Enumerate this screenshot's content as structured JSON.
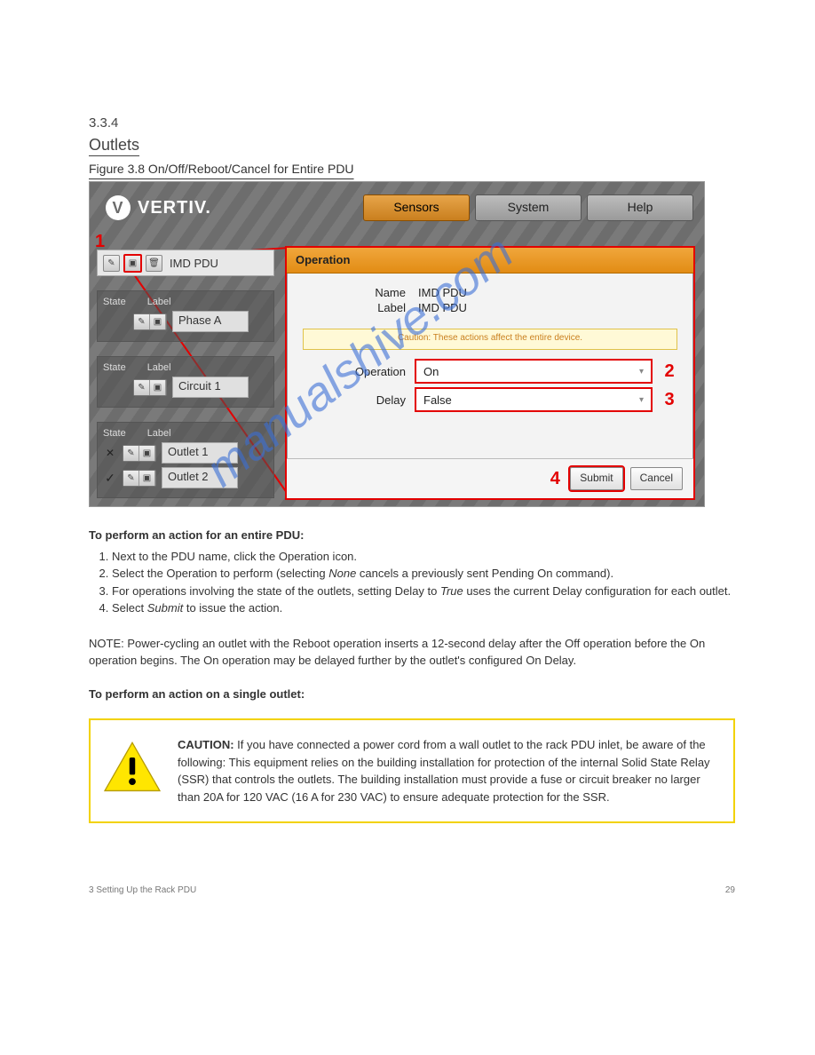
{
  "doc": {
    "section_number": "3.3.4",
    "section_title": "Outlets",
    "figure_caption": "Figure 3.8 On/Off/Reboot/Cancel for Entire PDU",
    "watermark": "manualshive.com",
    "footer_left": "3 Setting Up the Rack PDU",
    "footer_right": "29"
  },
  "app": {
    "brand": "VERTIV.",
    "nav": {
      "sensors": "Sensors",
      "system": "System",
      "help": "Help"
    },
    "callouts": {
      "one": "1",
      "two": "2",
      "three": "3",
      "four": "4"
    },
    "left": {
      "pdu_label": "IMD PDU",
      "state_header": "State",
      "label_header": "Label",
      "phase_label": "Phase A",
      "circuit_label": "Circuit 1",
      "outlets": [
        {
          "state": "✕",
          "label": "Outlet 1"
        },
        {
          "state": "✓",
          "label": "Outlet 2"
        }
      ]
    },
    "dialog": {
      "title": "Operation",
      "name_label": "Name",
      "name_value": "IMD PDU",
      "label_label": "Label",
      "label_value": "IMD PDU",
      "caution": "Caution: These actions affect the entire device.",
      "operation_label": "Operation",
      "operation_value": "On",
      "delay_label": "Delay",
      "delay_value": "False",
      "submit": "Submit",
      "cancel": "Cancel"
    }
  },
  "steps": {
    "intro_bold": "To perform an action for an entire PDU:",
    "s1": "Next to the PDU name, click the Operation icon.",
    "s2a": "Select the Operation to perform (selecting ",
    "s2_none": "None",
    "s2b": " cancels a previously sent Pending On command).",
    "s3a": "For operations involving the state of the outlets, setting Delay to ",
    "s3_true": "True",
    "s3b": " uses the current Delay configuration for each outlet.",
    "s4a": "Select ",
    "s4_submit": "Submit",
    "s4b": " to issue the action.",
    "sub_head": "To perform an action on a single outlet:",
    "note": "NOTE: Power-cycling an outlet with the Reboot operation inserts a 12-second delay after the Off operation before the On operation begins. The On operation may be delayed further by the outlet's configured On Delay."
  },
  "caution": {
    "lead": "CAUTION:",
    "body": " If you have connected a power cord from a wall outlet to the rack PDU inlet, be aware of the following: This equipment relies on the building installation for protection of the internal Solid State Relay (SSR) that controls the outlets. The building installation must provide a fuse or circuit breaker no larger than 20A for 120 VAC (16 A for 230 VAC) to ensure adequate protection for the SSR."
  }
}
